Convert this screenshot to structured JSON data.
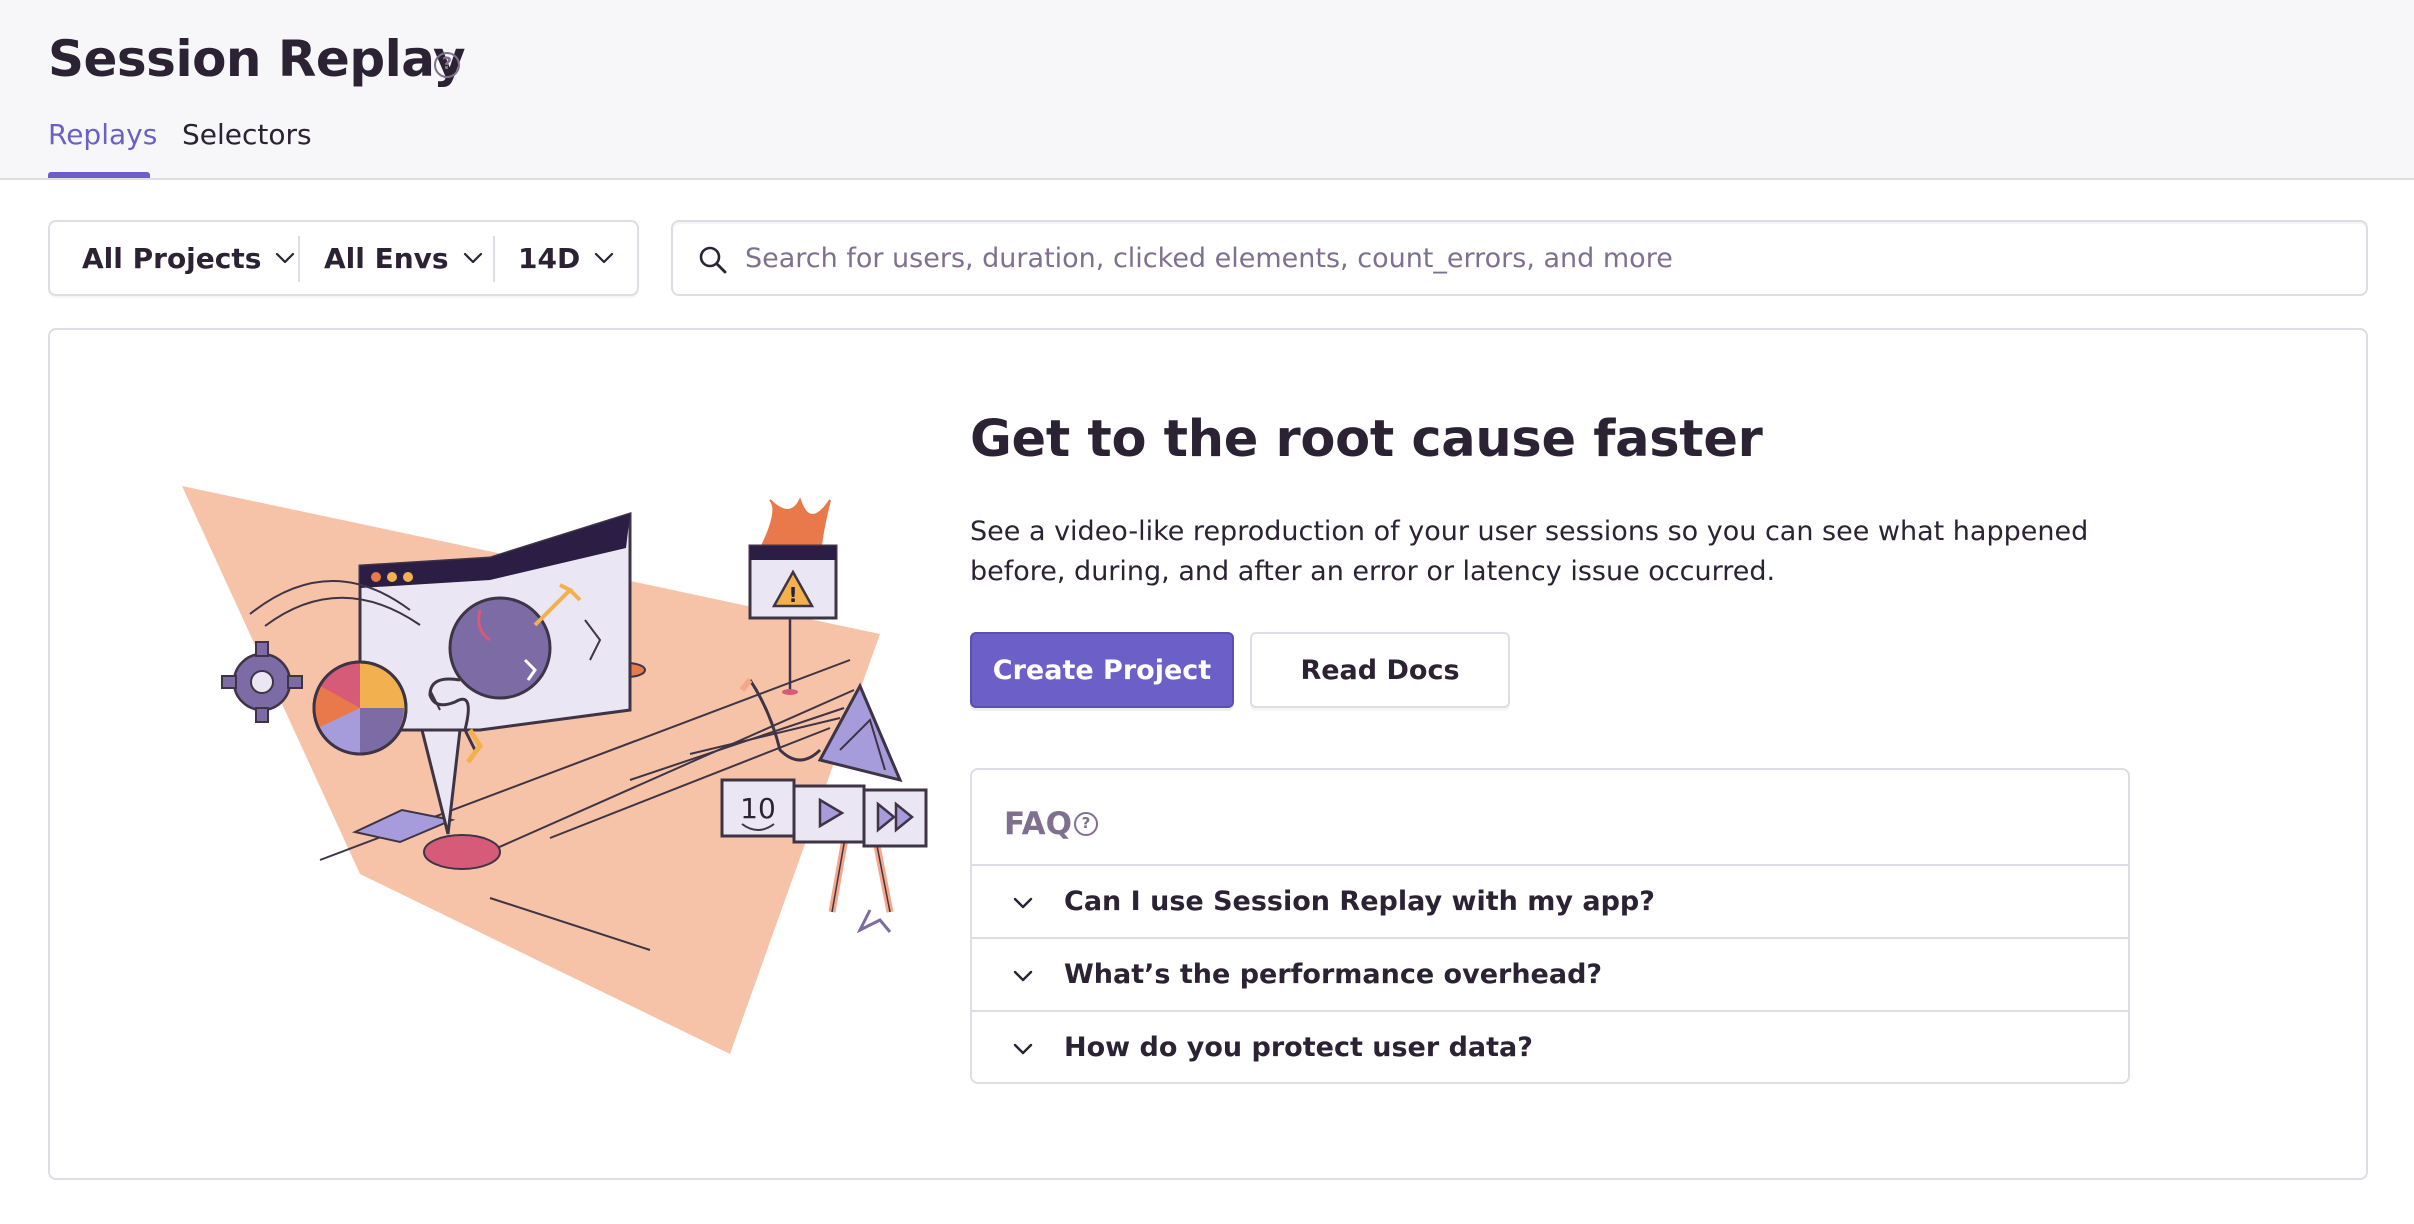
{
  "header": {
    "title": "Session Replay",
    "help_icon": "question-circle-icon",
    "tabs": [
      {
        "label": "Replays",
        "active": true
      },
      {
        "label": "Selectors",
        "active": false
      }
    ]
  },
  "filters": {
    "projects": "All Projects",
    "envs": "All Envs",
    "date": "14D"
  },
  "search": {
    "placeholder": "Search for users, duration, clicked elements, count_errors, and more",
    "value": ""
  },
  "empty_state": {
    "headline": "Get to the root cause faster",
    "description": "See a video-like reproduction of your user sessions so you can see what happened before, during, and after an error or latency issue occurred.",
    "primary_button": "Create Project",
    "secondary_button": "Read Docs",
    "illustration_text": "10",
    "faq": {
      "title": "FAQ",
      "items": [
        {
          "question": "Can I use Session Replay with my app?"
        },
        {
          "question": "What’s the performance overhead?"
        },
        {
          "question": "How do you protect user data?"
        }
      ]
    }
  },
  "colors": {
    "accent": "#6c5fc7",
    "text": "#2b2233",
    "muted": "#80708f",
    "border": "#e0dce5",
    "header_bg": "#f7f7f9",
    "illustration_peach": "#f6c3a9"
  }
}
